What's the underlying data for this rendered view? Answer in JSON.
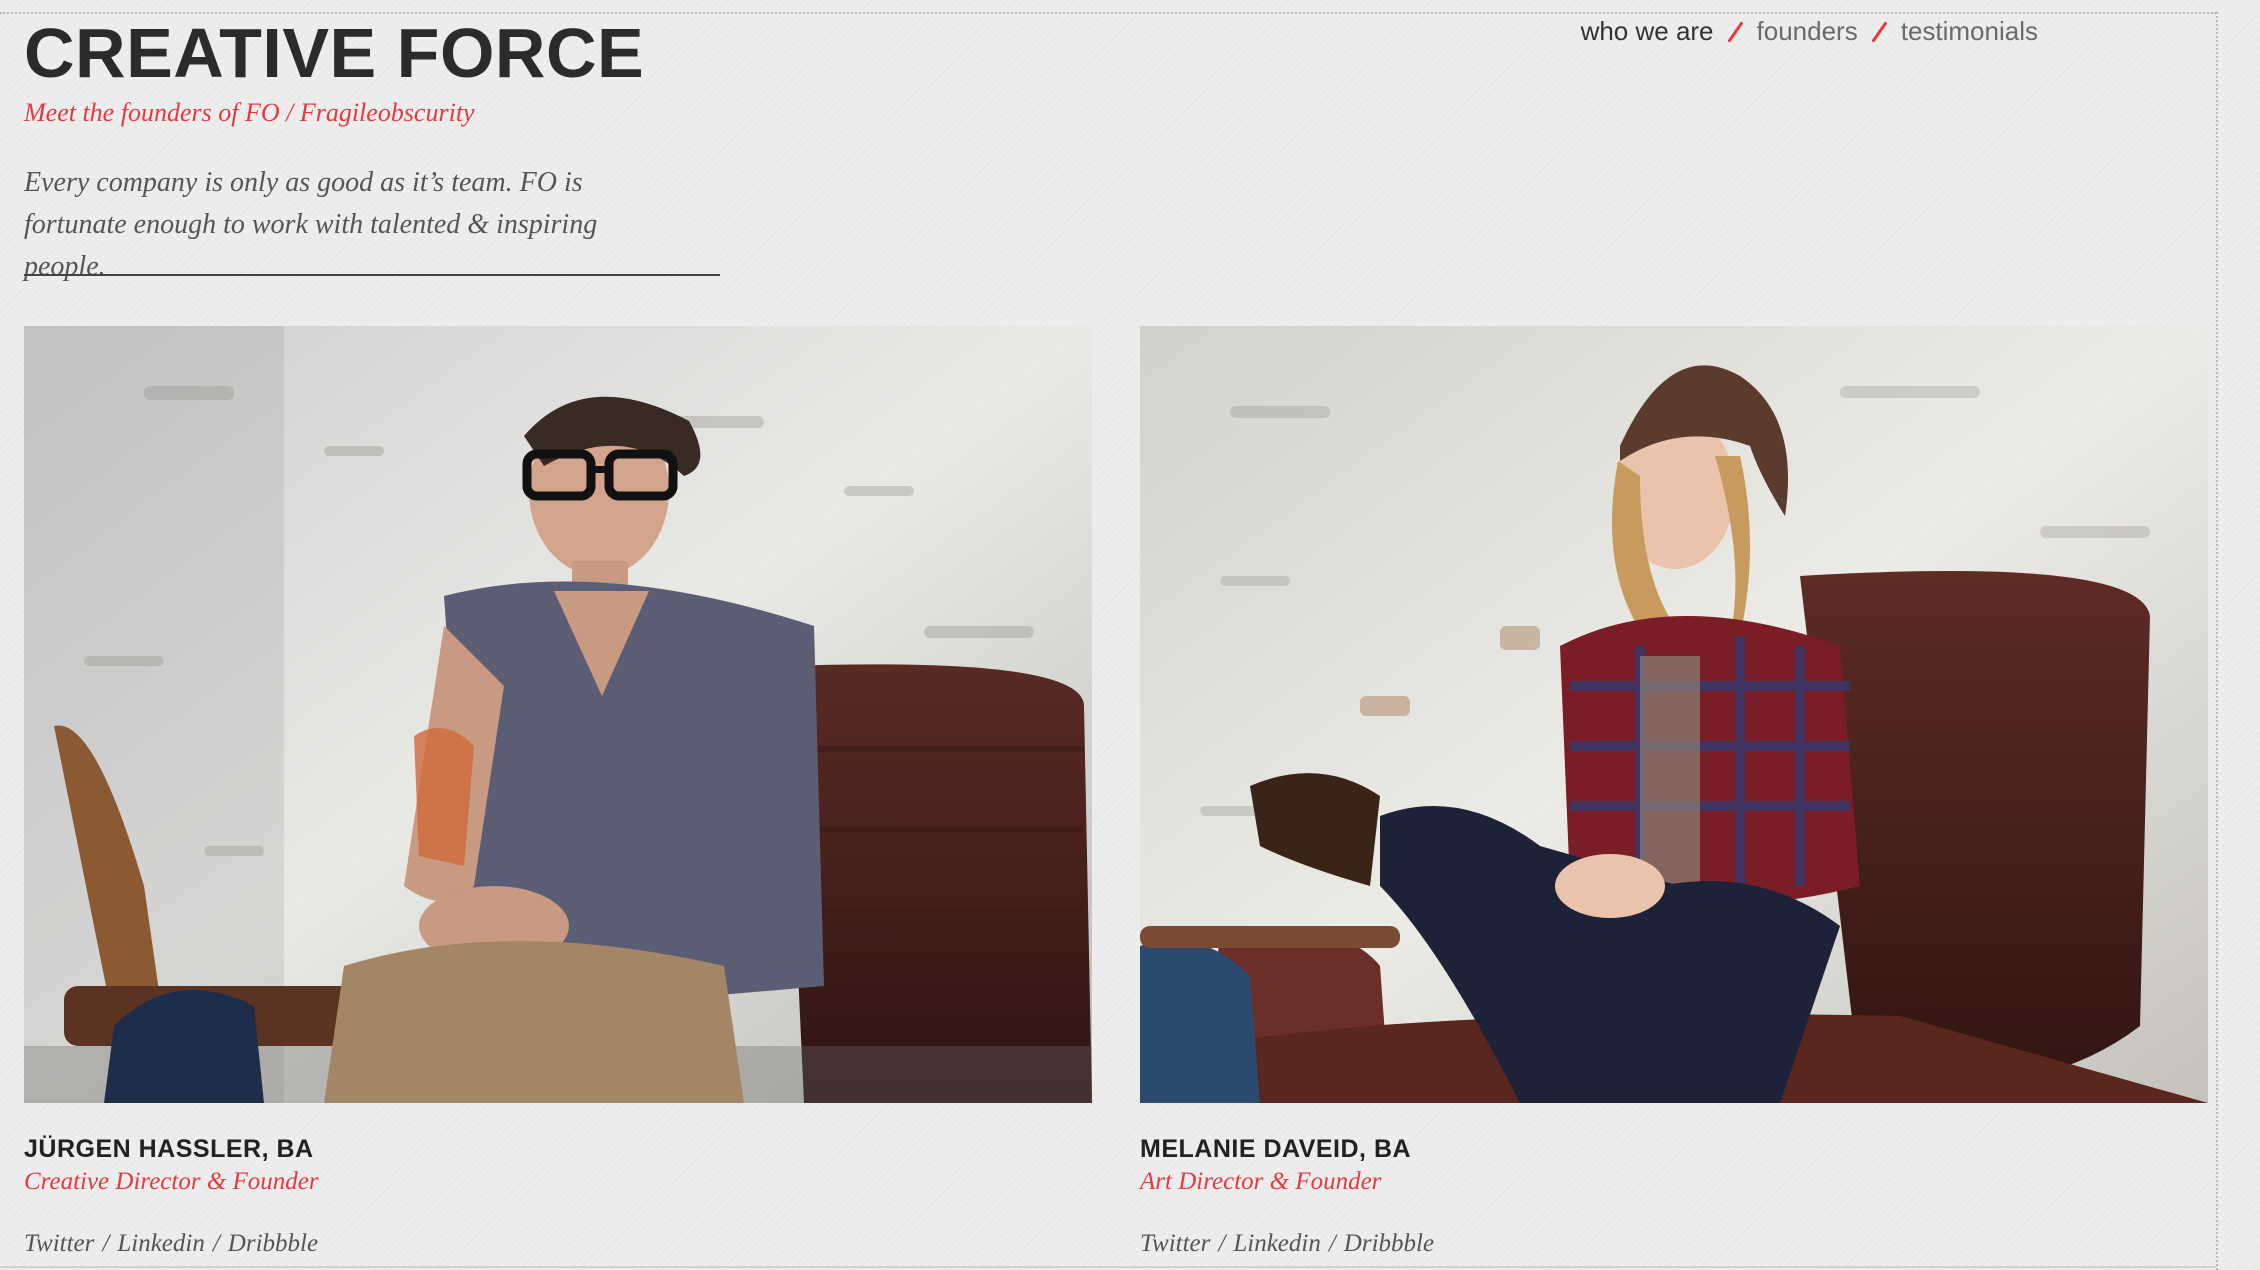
{
  "header": {
    "title": "CREATIVE FORCE",
    "subtitle": "Meet the founders of FO / Fragileobscurity",
    "intro": "Every company is only as good as it’s team. FO is fortunate enough to work with talented & inspiring people."
  },
  "nav": {
    "items": [
      {
        "label": "who we are",
        "state": "current"
      },
      {
        "label": "founders",
        "state": "link"
      },
      {
        "label": "testimonials",
        "state": "link"
      }
    ],
    "separator_color": "#e5393d"
  },
  "founders": [
    {
      "name": "JÜRGEN HASSLER, BA",
      "role": "Creative Director & Founder",
      "links": [
        "Twitter",
        "Linkedin",
        "Dribbble"
      ],
      "separator": "/"
    },
    {
      "name": "MELANIE DAVEID, BA",
      "role": "Art Director & Founder",
      "links": [
        "Twitter",
        "Linkedin",
        "Dribbble"
      ],
      "separator": "/"
    }
  ],
  "colors": {
    "accent": "#e5393d",
    "background": "#efefef",
    "text_dark": "#2b2b2b"
  }
}
